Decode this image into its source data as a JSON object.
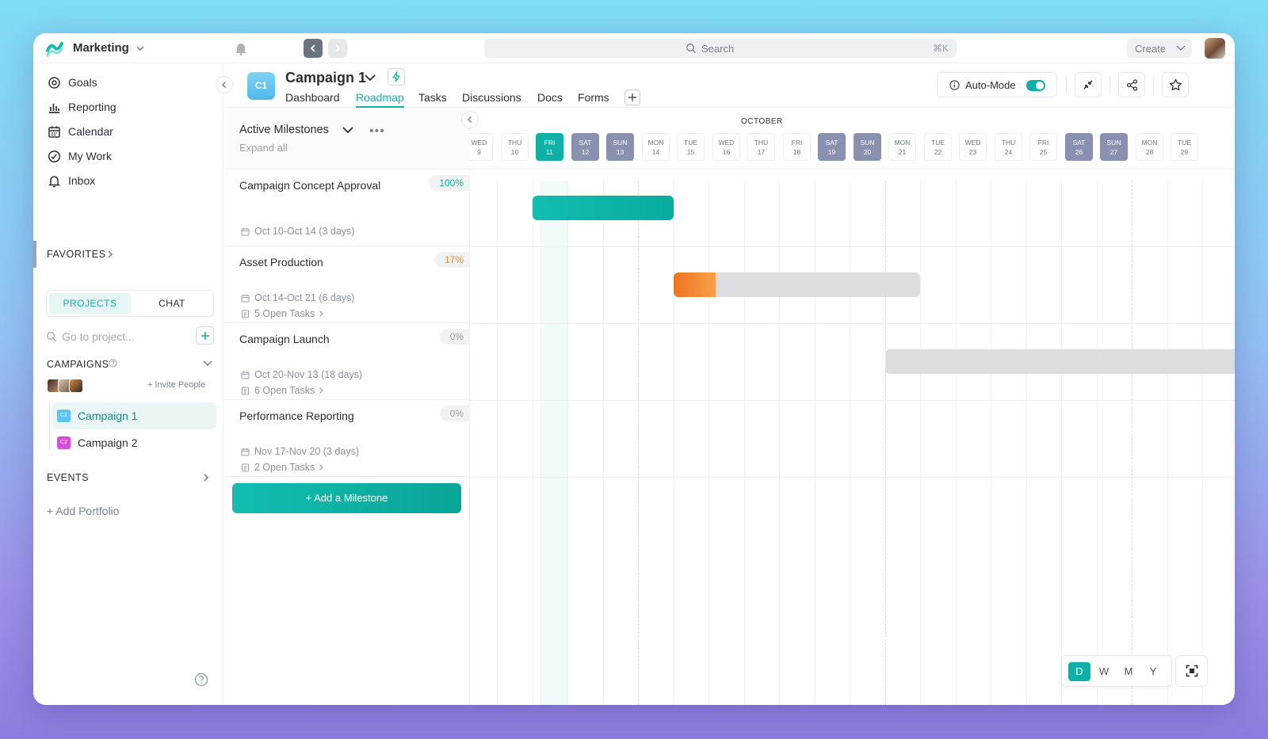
{
  "workspace": {
    "name": "Marketing"
  },
  "search": {
    "placeholder": "Search",
    "shortcut": "⌘K"
  },
  "create_label": "Create",
  "sidebar": {
    "nav": [
      {
        "label": "Goals",
        "icon": "goals-icon"
      },
      {
        "label": "Reporting",
        "icon": "reporting-icon"
      },
      {
        "label": "Calendar",
        "icon": "calendar-icon"
      },
      {
        "label": "My Work",
        "icon": "my-work-icon"
      },
      {
        "label": "Inbox",
        "icon": "inbox-icon"
      }
    ],
    "favorites": "FAVORITES",
    "tabs": {
      "projects": "PROJECTS",
      "chat": "CHAT"
    },
    "project_search_placeholder": "Go to project...",
    "campaigns_header": "CAMPAIGNS",
    "invite": "+ Invite People",
    "projects": [
      {
        "badge": "C1",
        "label": "Campaign 1",
        "color": "#5ec3f0"
      },
      {
        "badge": "C2",
        "label": "Campaign 2",
        "color": "#d04fd6"
      }
    ],
    "events": "EVENTS",
    "add_portfolio": "+ Add Portfolio"
  },
  "project": {
    "badge": "C1",
    "title": "Campaign 1",
    "tabs": [
      "Dashboard",
      "Roadmap",
      "Tasks",
      "Discussions",
      "Docs",
      "Forms"
    ],
    "active_tab": "Roadmap",
    "auto_mode": "Auto-Mode",
    "auto_mode_on": true
  },
  "milestones": {
    "header": "Active Milestones",
    "expand": "Expand all",
    "items": [
      {
        "name": "Campaign Concept Approval",
        "pct": "100%",
        "pct_color": "#0fb1a7",
        "dates": "Oct 10-Oct 14 (3 days)",
        "tasks": "",
        "progress": 1.0
      },
      {
        "name": "Asset Production",
        "pct": "17%",
        "pct_color": "#f08a2e",
        "dates": "Oct 14-Oct 21 (6 days)",
        "tasks": "5 Open Tasks",
        "progress": 0.17
      },
      {
        "name": "Campaign Launch",
        "pct": "0%",
        "pct_color": "#9aa0a8",
        "dates": "Oct 20-Nov 13 (18 days)",
        "tasks": "6 Open Tasks",
        "progress": 0
      },
      {
        "name": "Performance Reporting",
        "pct": "0%",
        "pct_color": "#9aa0a8",
        "dates": "Nov 17-Nov 20 (3 days)",
        "tasks": "2 Open Tasks",
        "progress": 0
      }
    ],
    "add_label": "+ Add a Milestone"
  },
  "timeline": {
    "month": "OCTOBER",
    "days": [
      {
        "dow": "WED",
        "d": "9",
        "kind": "normal"
      },
      {
        "dow": "THU",
        "d": "10",
        "kind": "normal"
      },
      {
        "dow": "FRI",
        "d": "11",
        "kind": "today"
      },
      {
        "dow": "SAT",
        "d": "12",
        "kind": "weekend"
      },
      {
        "dow": "SUN",
        "d": "13",
        "kind": "weekend"
      },
      {
        "dow": "MON",
        "d": "14",
        "kind": "normal"
      },
      {
        "dow": "TUE",
        "d": "15",
        "kind": "normal"
      },
      {
        "dow": "WED",
        "d": "16",
        "kind": "normal"
      },
      {
        "dow": "THU",
        "d": "17",
        "kind": "normal"
      },
      {
        "dow": "FRI",
        "d": "18",
        "kind": "normal"
      },
      {
        "dow": "SAT",
        "d": "19",
        "kind": "weekend"
      },
      {
        "dow": "SUN",
        "d": "20",
        "kind": "weekend"
      },
      {
        "dow": "MON",
        "d": "21",
        "kind": "normal"
      },
      {
        "dow": "TUE",
        "d": "22",
        "kind": "normal"
      },
      {
        "dow": "WED",
        "d": "23",
        "kind": "normal"
      },
      {
        "dow": "THU",
        "d": "24",
        "kind": "normal"
      },
      {
        "dow": "FRI",
        "d": "25",
        "kind": "normal"
      },
      {
        "dow": "SAT",
        "d": "26",
        "kind": "weekend"
      },
      {
        "dow": "SUN",
        "d": "27",
        "kind": "weekend"
      },
      {
        "dow": "MON",
        "d": "28",
        "kind": "normal"
      },
      {
        "dow": "TUE",
        "d": "29",
        "kind": "normal"
      }
    ],
    "zoom": [
      "D",
      "W",
      "M",
      "Y"
    ],
    "zoom_active": "D",
    "colors": {
      "done": "#0fb8ab",
      "progress": "#f47d24",
      "remaining": "#dcdde0"
    }
  }
}
